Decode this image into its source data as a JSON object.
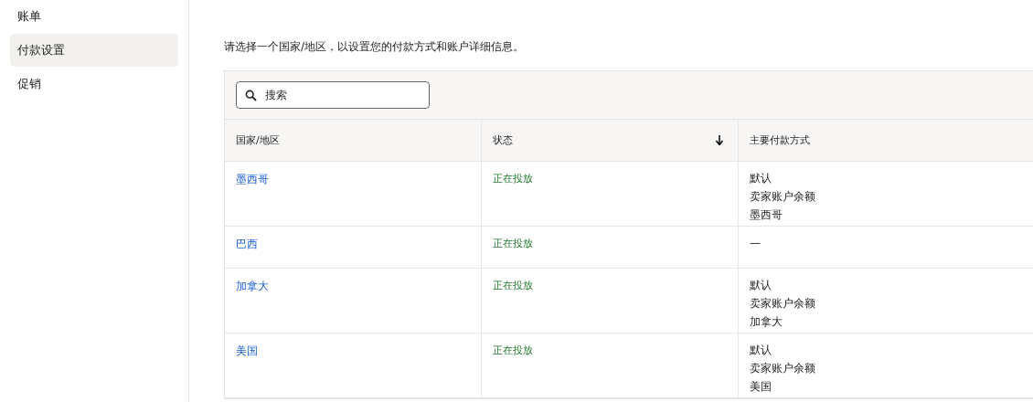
{
  "sidebar": {
    "items": [
      {
        "label": "账单",
        "selected": false
      },
      {
        "label": "付款设置",
        "selected": true
      },
      {
        "label": "促销",
        "selected": false
      }
    ]
  },
  "intro": "请选择一个国家/地区，以设置您的付款方式和账户详细信息。",
  "search": {
    "placeholder": "搜索"
  },
  "table": {
    "columns": [
      {
        "label": "国家/地区",
        "sorted": false
      },
      {
        "label": "状态",
        "sorted": true
      },
      {
        "label": "主要付款方式",
        "sorted": false
      }
    ],
    "rows": [
      {
        "country": "墨西哥",
        "status": "正在投放",
        "methods": [
          "默认",
          "卖家账户余额",
          "墨西哥"
        ]
      },
      {
        "country": "巴西",
        "status": "正在投放",
        "methods": [
          "—"
        ]
      },
      {
        "country": "加拿大",
        "status": "正在投放",
        "methods": [
          "默认",
          "卖家账户余额",
          "加拿大"
        ]
      },
      {
        "country": "美国",
        "status": "正在投放",
        "methods": [
          "默认",
          "卖家账户余额",
          "美国"
        ]
      }
    ]
  }
}
